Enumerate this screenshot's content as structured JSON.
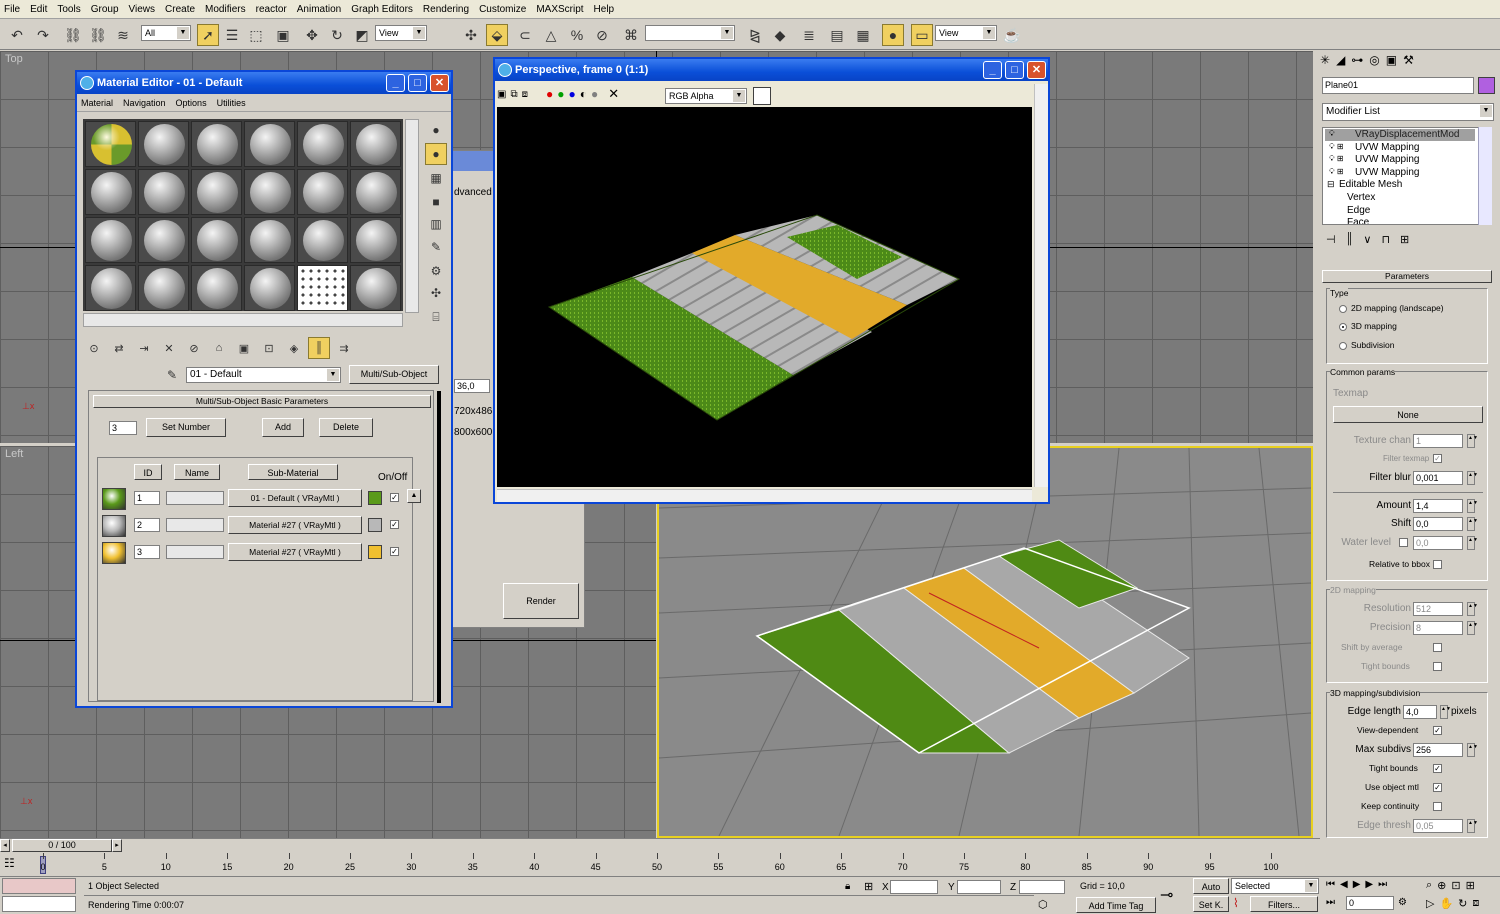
{
  "menu": [
    "File",
    "Edit",
    "Tools",
    "Group",
    "Views",
    "Create",
    "Modifiers",
    "reactor",
    "Animation",
    "Graph Editors",
    "Rendering",
    "Customize",
    "MAXScript",
    "Help"
  ],
  "toolbar": {
    "selection_filter": "All",
    "ref_coord": "View",
    "named_selection": "",
    "render_view": "View"
  },
  "viewports": {
    "top": {
      "label": "Top"
    },
    "left": {
      "label": "Left"
    }
  },
  "material_editor": {
    "title": "Material Editor - 01 - Default",
    "menu": [
      "Material",
      "Navigation",
      "Options",
      "Utilities"
    ],
    "material_name": "01 - Default",
    "material_type": "Multi/Sub-Object",
    "rollout_title": "Multi/Sub-Object Basic Parameters",
    "count": "3",
    "set_number": "Set Number",
    "add": "Add",
    "delete": "Delete",
    "col_id": "ID",
    "col_name": "Name",
    "col_sub": "Sub-Material",
    "col_onoff": "On/Off",
    "rows": [
      {
        "id": "1",
        "name": "",
        "sub": "01 - Default  ( VRayMtl )",
        "color": "#5a9a1a"
      },
      {
        "id": "2",
        "name": "",
        "sub": "Material #27  ( VRayMtl )",
        "color": "#b8b8b8"
      },
      {
        "id": "3",
        "name": "",
        "sub": "Material #27  ( VRayMtl )",
        "color": "#f0c030"
      }
    ],
    "check_mark": "✓"
  },
  "render_setup": {
    "tab_partial": "dvanced L",
    "value1": "36,0",
    "value2": "720x486",
    "value3": "800x600",
    "render": "Render"
  },
  "frame_window": {
    "title": "Perspective, frame 0 (1:1)",
    "channel": "RGB Alpha"
  },
  "command_panel": {
    "object_name": "Plane01",
    "modifier_list": "Modifier List",
    "stack": [
      {
        "label": "VRayDisplacementMod",
        "indent": 0
      },
      {
        "label": "UVW Mapping",
        "indent": 0
      },
      {
        "label": "UVW Mapping",
        "indent": 0
      },
      {
        "label": "UVW Mapping",
        "indent": 0
      },
      {
        "label": "Editable Mesh",
        "indent": 0
      },
      {
        "label": "Vertex",
        "indent": 1
      },
      {
        "label": "Edge",
        "indent": 1
      },
      {
        "label": "Face",
        "indent": 1
      }
    ],
    "parameters": "Parameters",
    "type": "Type",
    "type_options": [
      "2D mapping (landscape)",
      "3D mapping",
      "Subdivision"
    ],
    "common_params": "Common params",
    "texmap": "Texmap",
    "none": "None",
    "texture_chan": "Texture chan",
    "texture_chan_val": "1",
    "filter_texmap": "Filter texmap",
    "filter_blur": "Filter blur",
    "filter_blur_val": "0,001",
    "amount": "Amount",
    "amount_val": "1,4",
    "shift": "Shift",
    "shift_val": "0,0",
    "water_level": "Water level",
    "water_level_val": "0,0",
    "relative_bbox": "Relative to bbox",
    "mapping2d": "2D mapping",
    "resolution": "Resolution",
    "resolution_val": "512",
    "precision": "Precision",
    "precision_val": "8",
    "shift_avg": "Shift by average",
    "tight_bounds": "Tight bounds",
    "mapping3d": "3D mapping/subdivision",
    "edge_length": "Edge length",
    "edge_length_val": "4,0",
    "pixels": "pixels",
    "view_dependent": "View-dependent",
    "max_subdivs": "Max subdivs",
    "max_subdivs_val": "256",
    "tight_bounds2": "Tight bounds",
    "use_object_mtl": "Use object mtl",
    "keep_continuity": "Keep continuity",
    "edge_thresh": "Edge thresh",
    "edge_thresh_val": "0,05"
  },
  "timeline": {
    "frame": "0 / 100",
    "ticks": [
      "0",
      "5",
      "10",
      "15",
      "20",
      "25",
      "30",
      "35",
      "40",
      "45",
      "50",
      "55",
      "60",
      "65",
      "70",
      "75",
      "80",
      "85",
      "90",
      "95",
      "100"
    ]
  },
  "status": {
    "selected": "1 Object Selected",
    "render_time": "Rendering Time  0:00:07",
    "x": "X",
    "y": "Y",
    "z": "Z",
    "grid": "Grid = 10,0",
    "add_time_tag": "Add Time Tag",
    "auto": "Auto",
    "setk": "Set K.",
    "selected_dd": "Selected",
    "filters": "Filters...",
    "frame_field": "0"
  }
}
